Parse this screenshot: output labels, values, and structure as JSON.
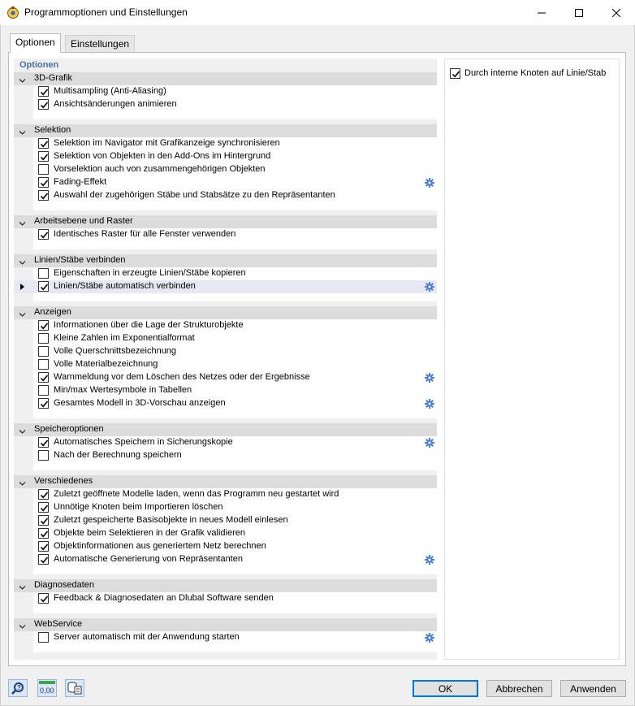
{
  "window": {
    "title": "Programmoptionen und Einstellungen"
  },
  "tabs": [
    {
      "label": "Optionen",
      "active": true
    },
    {
      "label": "Einstellungen",
      "active": false
    }
  ],
  "options_header": "Optionen",
  "sections": [
    {
      "title": "3D-Grafik",
      "items": [
        {
          "label": "Multisampling (Anti-Aliasing)",
          "checked": true
        },
        {
          "label": "Ansichtsänderungen animieren",
          "checked": true
        }
      ]
    },
    {
      "title": "Selektion",
      "items": [
        {
          "label": "Selektion im Navigator mit Grafikanzeige synchronisieren",
          "checked": true
        },
        {
          "label": "Selektion von Objekten in den Add-Ons im Hintergrund",
          "checked": true
        },
        {
          "label": "Vorselektion auch von zusammengehörigen Objekten",
          "checked": false
        },
        {
          "label": "Fading-Effekt",
          "checked": true,
          "gear": true
        },
        {
          "label": "Auswahl der zugehörigen Stäbe und Stabsätze zu den Repräsentanten",
          "checked": true
        }
      ]
    },
    {
      "title": "Arbeitsebene und Raster",
      "items": [
        {
          "label": "Identisches Raster für alle Fenster verwenden",
          "checked": true
        }
      ]
    },
    {
      "title": "Linien/Stäbe verbinden",
      "items": [
        {
          "label": "Eigenschaften in erzeugte Linien/Stäbe kopieren",
          "checked": false
        },
        {
          "label": "Linien/Stäbe automatisch verbinden",
          "checked": true,
          "gear": true,
          "selected": true
        }
      ]
    },
    {
      "title": "Anzeigen",
      "items": [
        {
          "label": "Informationen über die Lage der Strukturobjekte",
          "checked": true
        },
        {
          "label": "Kleine Zahlen im Exponentialformat",
          "checked": false
        },
        {
          "label": "Volle Querschnittsbezeichnung",
          "checked": false
        },
        {
          "label": "Volle Materialbezeichnung",
          "checked": false
        },
        {
          "label": "Warnmeldung vor dem Löschen des Netzes oder der Ergebnisse",
          "checked": true,
          "gear": true
        },
        {
          "label": "Min/max Wertesymbole in Tabellen",
          "checked": false
        },
        {
          "label": "Gesamtes Modell in 3D-Vorschau anzeigen",
          "checked": true,
          "gear": true
        }
      ]
    },
    {
      "title": "Speicheroptionen",
      "items": [
        {
          "label": "Automatisches Speichern in Sicherungskopie",
          "checked": true,
          "gear": true
        },
        {
          "label": "Nach der Berechnung speichern",
          "checked": false
        }
      ]
    },
    {
      "title": "Verschiedenes",
      "items": [
        {
          "label": "Zuletzt geöffnete Modelle laden, wenn das Programm neu gestartet wird",
          "checked": true
        },
        {
          "label": "Unnötige Knoten beim Importieren löschen",
          "checked": true
        },
        {
          "label": "Zuletzt gespeicherte Basisobjekte in neues Modell einlesen",
          "checked": true
        },
        {
          "label": "Objekte beim Selektieren in der Grafik validieren",
          "checked": true
        },
        {
          "label": "Objektinformationen aus generiertem Netz berechnen",
          "checked": true
        },
        {
          "label": "Automatische Generierung von Repräsentanten",
          "checked": true,
          "gear": true
        }
      ]
    },
    {
      "title": "Diagnosedaten",
      "items": [
        {
          "label": "Feedback & Diagnosedaten an Dlubal Software senden",
          "checked": true
        }
      ]
    },
    {
      "title": "WebService",
      "items": [
        {
          "label": "Server automatisch mit der Anwendung starten",
          "checked": false,
          "gear": true
        }
      ]
    }
  ],
  "right_panel": {
    "label": "Durch interne Knoten auf Linie/Stab",
    "checked": true
  },
  "footer_icons": [
    {
      "name": "help-icon"
    },
    {
      "name": "units-icon",
      "text": "0,00"
    },
    {
      "name": "settings-list-icon"
    }
  ],
  "buttons": {
    "ok": "OK",
    "cancel": "Abbrechen",
    "apply": "Anwenden"
  },
  "colors": {
    "accent": "#0078d7",
    "section_header": "#dcdcdc",
    "options_header": "#4a6fa5",
    "selected_row": "#e8e8f5",
    "gear": "#4a7fd0"
  }
}
